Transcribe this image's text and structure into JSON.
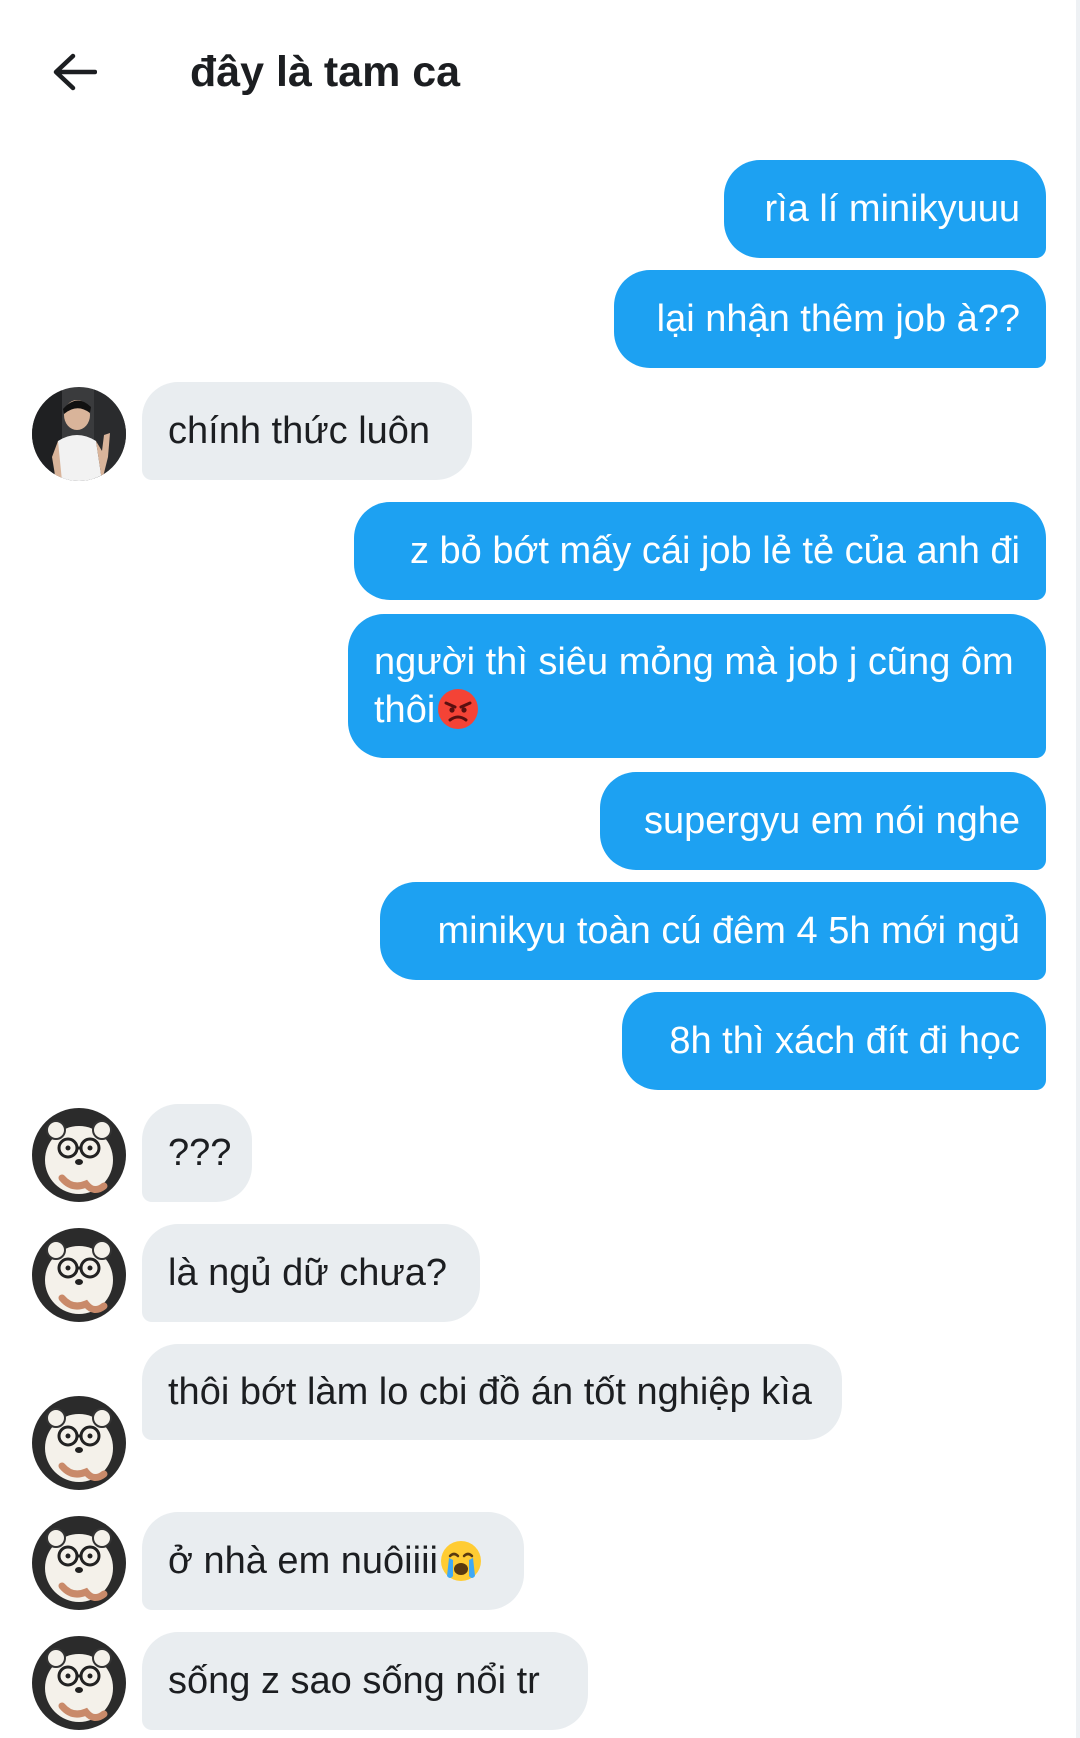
{
  "header": {
    "title": "đây là tam ca"
  },
  "messages": [
    {
      "side": "sent",
      "text": "rìa lí minikyuuu"
    },
    {
      "side": "sent",
      "text": "lại nhận thêm job à??"
    },
    {
      "side": "received",
      "sender": "photo-avatar",
      "text": "chính thức luôn"
    },
    {
      "side": "sent",
      "text": "z bỏ bớt mấy cái job lẻ tẻ của anh đi"
    },
    {
      "side": "sent",
      "text": "người thì siêu mỏng mà job j cũng ôm thôi",
      "emoji": "angry-face-emoji"
    },
    {
      "side": "sent",
      "text": "supergyu em nói nghe"
    },
    {
      "side": "sent",
      "text": "minikyu toàn cú đêm 4 5h mới ngủ"
    },
    {
      "side": "sent",
      "text": "8h thì xách đít đi học"
    },
    {
      "side": "received",
      "sender": "bear-avatar",
      "text": "???"
    },
    {
      "side": "received",
      "sender": "bear-avatar",
      "text": "là ngủ dữ chưa?"
    },
    {
      "side": "received",
      "sender": "bear-avatar",
      "text": "thôi bớt làm lo cbi đồ án tốt nghiệp kìa"
    },
    {
      "side": "received",
      "sender": "bear-avatar",
      "text": "ở nhà em nuôiiii",
      "emoji": "crying-face-emoji"
    },
    {
      "side": "received",
      "sender": "bear-avatar",
      "text": "sống z sao sống nổi tr"
    }
  ],
  "colors": {
    "sent_bubble": "#1da1f2",
    "received_bubble": "#e9edf0",
    "text_dark": "#1c1e21"
  }
}
